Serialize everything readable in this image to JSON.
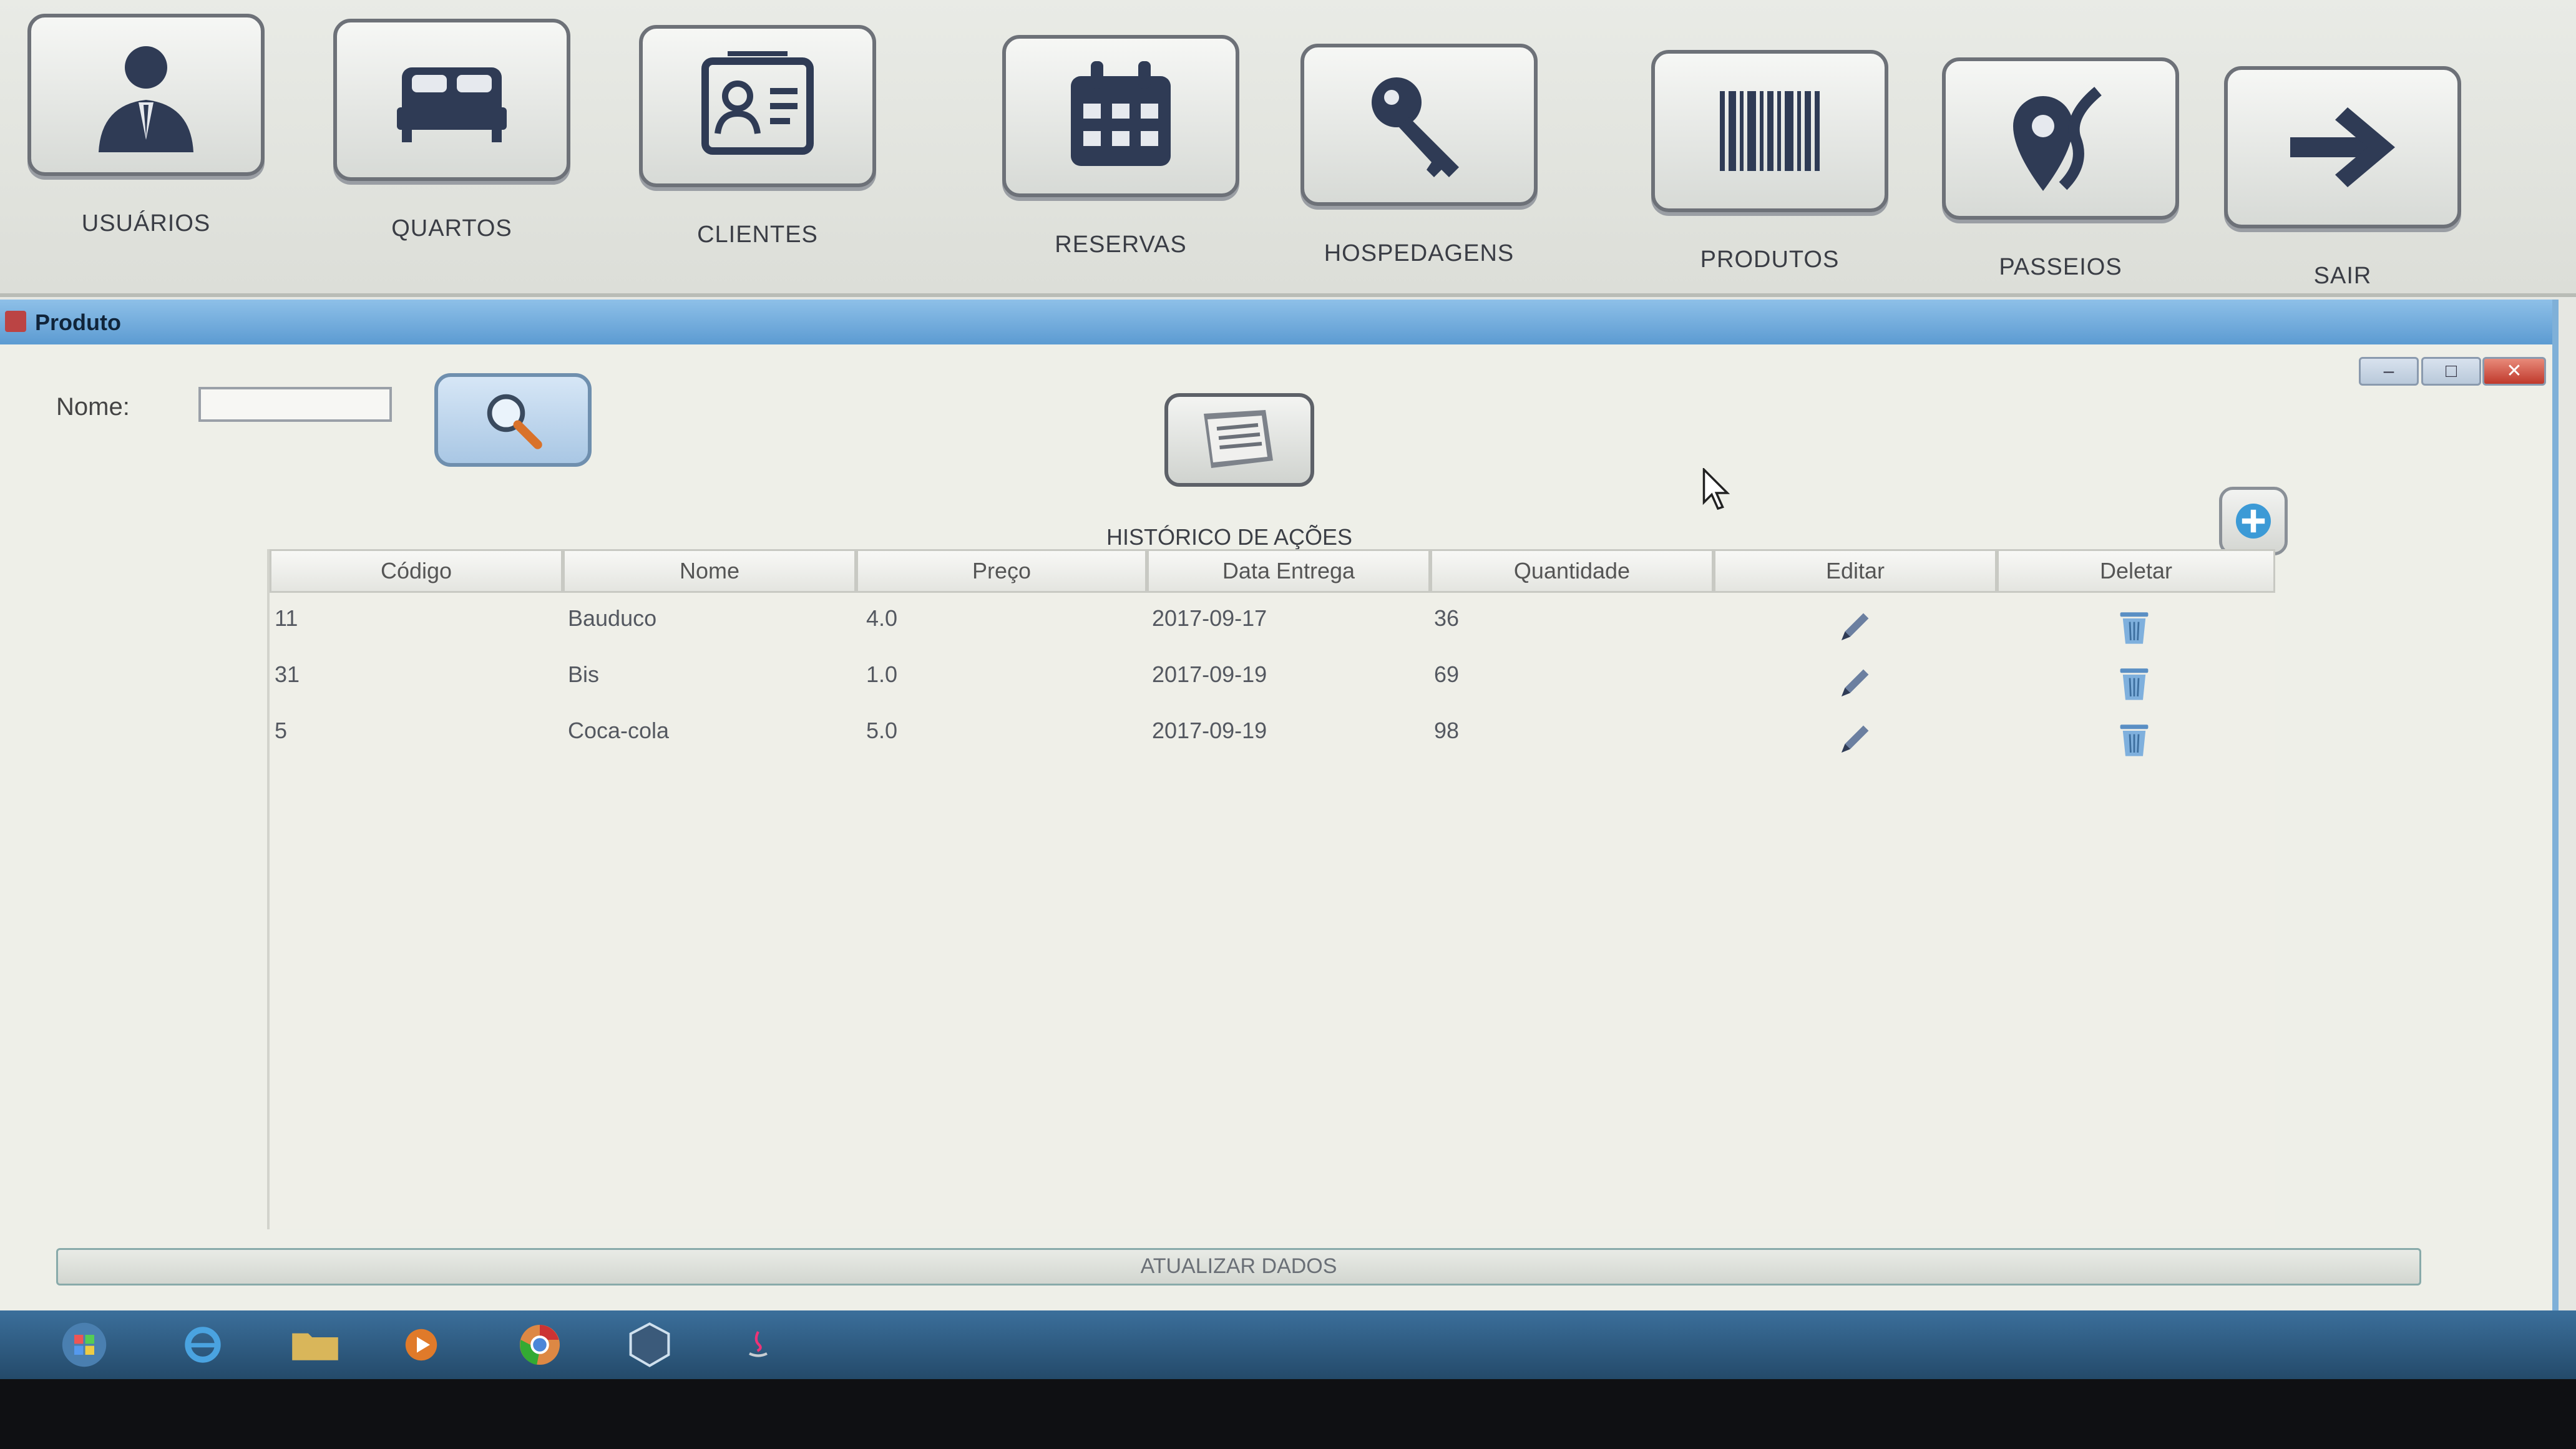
{
  "toolbar": {
    "items": [
      {
        "label": "USUÁRIOS",
        "icon": "user-icon"
      },
      {
        "label": "QUARTOS",
        "icon": "bed-icon"
      },
      {
        "label": "CLIENTES",
        "icon": "id-card-icon"
      },
      {
        "label": "RESERVAS",
        "icon": "calendar-icon"
      },
      {
        "label": "HOSPEDAGENS",
        "icon": "key-icon"
      },
      {
        "label": "PRODUTOS",
        "icon": "barcode-icon"
      },
      {
        "label": "PASSEIOS",
        "icon": "map-pin-icon"
      },
      {
        "label": "SAIR",
        "icon": "arrow-right-icon"
      }
    ]
  },
  "window": {
    "title": "Produto"
  },
  "search": {
    "label": "Nome:",
    "value": ""
  },
  "history": {
    "label": "HISTÓRICO DE AÇÕES"
  },
  "table": {
    "columns": [
      "Código",
      "Nome",
      "Preço",
      "Data Entrega",
      "Quantidade",
      "Editar",
      "Deletar"
    ],
    "rows": [
      {
        "codigo": "11",
        "nome": "Bauduco",
        "preco": "4.0",
        "data": "2017-09-17",
        "quantidade": "36"
      },
      {
        "codigo": "31",
        "nome": "Bis",
        "preco": "1.0",
        "data": "2017-09-19",
        "quantidade": "69"
      },
      {
        "codigo": "5",
        "nome": "Coca-cola",
        "preco": "5.0",
        "data": "2017-09-19",
        "quantidade": "98"
      }
    ]
  },
  "refresh": {
    "label": "ATUALIZAR DADOS"
  },
  "colors": {
    "accent": "#2f3b55",
    "titlebar": "#5c9bd2",
    "icon_blue": "#5a8fc4"
  }
}
